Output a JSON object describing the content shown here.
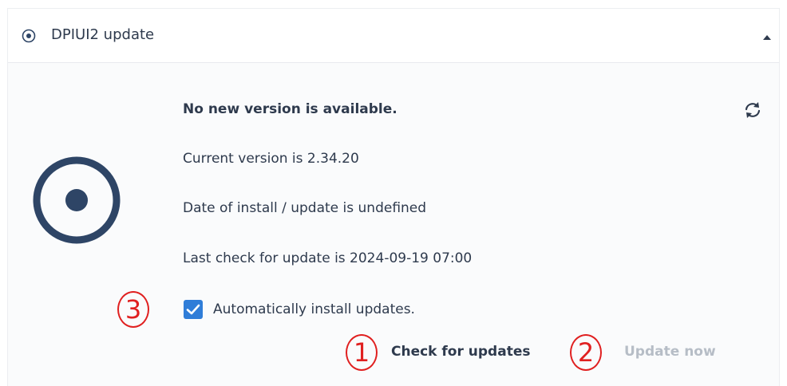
{
  "header": {
    "title": "DPIUI2 update",
    "icon": "radio-dot-icon",
    "collapse_icon": "caret-up-icon"
  },
  "status": {
    "headline": "No new version is available.",
    "current_version": "Current version is 2.34.20",
    "install_date": "Date of install / update is undefined",
    "last_check": "Last check for update is 2024-09-19 07:00",
    "refresh_icon": "refresh-icon"
  },
  "auto_install": {
    "label": "Automatically install updates.",
    "checked": true
  },
  "actions": {
    "check_label": "Check for updates",
    "update_label": "Update now",
    "update_enabled": false
  },
  "annotations": {
    "marker_1": "1",
    "marker_2": "2",
    "marker_3": "3"
  },
  "colors": {
    "text": "#2e3a4d",
    "icon": "#2e4566",
    "checkbox": "#2f7dd8",
    "disabled": "#b6bdc6",
    "annotation": "#e02020"
  }
}
